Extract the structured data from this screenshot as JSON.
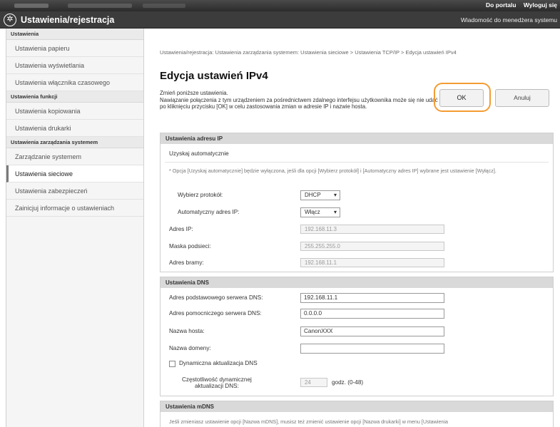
{
  "topbar": {
    "portal_link": "Do portalu",
    "logout_link": "Wyloguj się"
  },
  "header": {
    "title": "Ustawienia/rejestracja",
    "admin_message": "Wiadomość do menedżera systemu"
  },
  "sidebar": {
    "section1": "Ustawienia",
    "items1": [
      "Ustawienia papieru",
      "Ustawienia wyświetlania",
      "Ustawienia włącznika czasowego"
    ],
    "section2": "Ustawienia funkcji",
    "items2": [
      "Ustawienia kopiowania",
      "Ustawienia drukarki"
    ],
    "section3": "Ustawienia zarządzania systemem",
    "items3": [
      "Zarządzanie systemem",
      "Ustawienia sieciowe",
      "Ustawienia zabezpieczeń",
      "Zainicjuj informacje o ustawieniach"
    ]
  },
  "main": {
    "breadcrumb": "Ustawienia/rejestracja: Ustawienia zarządzania systemem: Ustawienia sieciowe > Ustawienia TCP/IP > Edycja ustawień IPv4",
    "page_title": "Edycja ustawień IPv4",
    "description": "Zmień poniższe ustawienia.\nNawiązanie połączenia z tym urządzeniem za pośrednictwem zdalnego interfejsu użytkownika może się nie udać po kliknięciu przycisku [OK] w celu zastosowania zmian w adresie IP i nazwie hosta.",
    "ok_label": "OK",
    "cancel_label": "Anuluj"
  },
  "ip": {
    "section_title": "Ustawienia adresu IP",
    "auto_label": "Uzyskaj automatycznie",
    "note": "* Opcja [Uzyskaj automatycznie] będzie wyłączona, jeśli dla opcji [Wybierz protokół] i [Automatyczny adres IP] wybrane jest ustawienie [Wyłącz].",
    "protocol_label": "Wybierz protokół:",
    "protocol_value": "DHCP",
    "auto_ip_label": "Automatyczny adres IP:",
    "auto_ip_value": "Włącz",
    "address_label": "Adres IP:",
    "address_value": "192.168.11.3",
    "mask_label": "Maska podsieci:",
    "mask_value": "255.255.255.0",
    "gateway_label": "Adres bramy:",
    "gateway_value": "192.168.11.1"
  },
  "dns": {
    "section_title": "Ustawienia DNS",
    "primary_label": "Adres podstawowego serwera DNS:",
    "primary_value": "192.168.11.1",
    "secondary_label": "Adres pomocniczego serwera DNS:",
    "secondary_value": "0.0.0.0",
    "host_label": "Nazwa hosta:",
    "host_value": "CanonXXX",
    "domain_label": "Nazwa domeny:",
    "domain_value": "",
    "dynamic_label": "Dynamiczna aktualizacja DNS",
    "interval_label_1": "Częstotliwość dynamicznej",
    "interval_label_2": "aktualizacji DNS:",
    "interval_value": "24",
    "interval_unit": "godz. (0-48)"
  },
  "mdns": {
    "section_title": "Ustawienia mDNS",
    "note": "Jeśli zmieniasz ustawienie opcji [Nazwa mDNS], musisz też zmienić ustawienie opcji [Nazwa drukarki] w menu [Ustawienia"
  }
}
